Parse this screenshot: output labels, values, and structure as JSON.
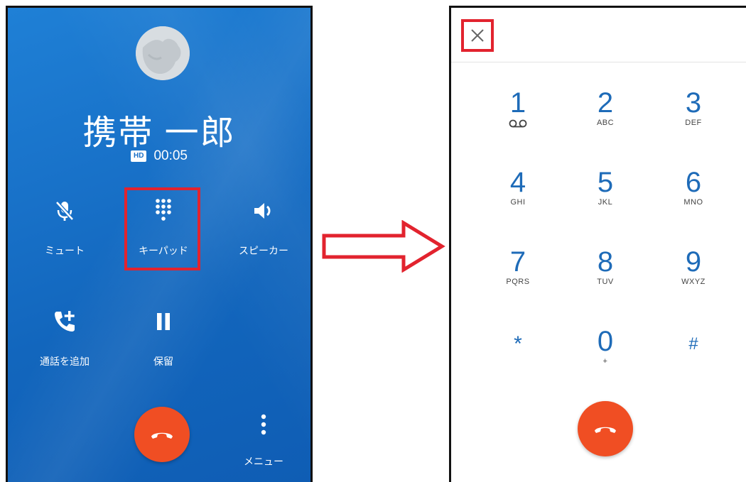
{
  "incall": {
    "caller_name": "携帯 一郎",
    "hd_badge": "HD",
    "duration": "00:05",
    "controls": [
      {
        "label": "ミュート",
        "icon": "mic-off-icon"
      },
      {
        "label": "キーパッド",
        "icon": "dialpad-icon"
      },
      {
        "label": "スピーカー",
        "icon": "speaker-icon"
      },
      {
        "label": "通話を追加",
        "icon": "add-call-icon"
      },
      {
        "label": "保留",
        "icon": "pause-icon"
      }
    ],
    "menu_label": "メニュー",
    "colors": {
      "background": "#1870c8",
      "end_call": "#f04e23",
      "highlight": "#e2232e"
    }
  },
  "arrow": {
    "icon": "right-arrow-icon"
  },
  "dialpad": {
    "close_icon": "close-icon",
    "keys": [
      {
        "digit": "1",
        "sub": "voicemail"
      },
      {
        "digit": "2",
        "sub": "ABC"
      },
      {
        "digit": "3",
        "sub": "DEF"
      },
      {
        "digit": "4",
        "sub": "GHI"
      },
      {
        "digit": "5",
        "sub": "JKL"
      },
      {
        "digit": "6",
        "sub": "MNO"
      },
      {
        "digit": "7",
        "sub": "PQRS"
      },
      {
        "digit": "8",
        "sub": "TUV"
      },
      {
        "digit": "9",
        "sub": "WXYZ"
      },
      {
        "digit": "*",
        "sub": ""
      },
      {
        "digit": "0",
        "sub": "+"
      },
      {
        "digit": "#",
        "sub": ""
      }
    ],
    "colors": {
      "digit": "#1e6bb8",
      "end_call": "#f04e23"
    }
  }
}
